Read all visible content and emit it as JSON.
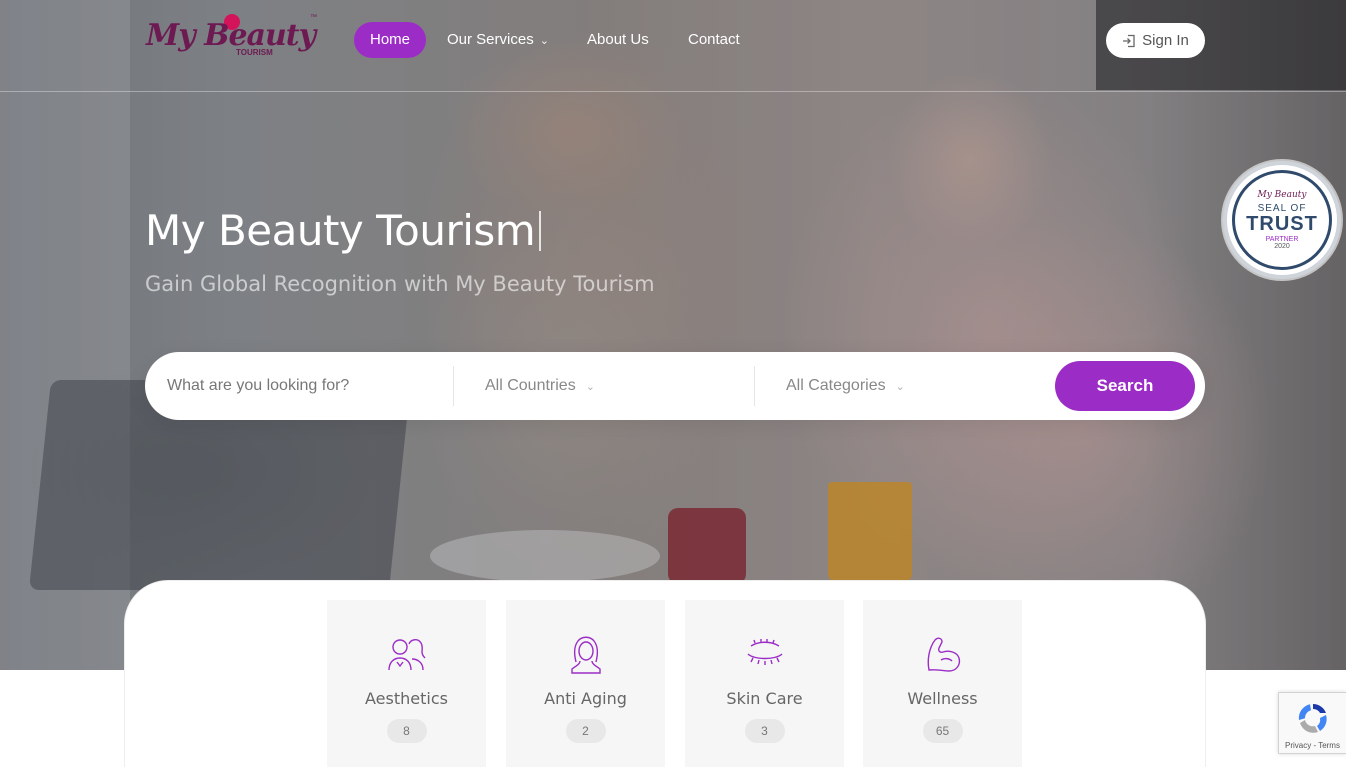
{
  "brand": {
    "logo_text": "My Beauty",
    "logo_sub": "TOURISM",
    "logo_tm": "™",
    "accent_color": "#9b2dc6",
    "logo_color": "#6d1a52"
  },
  "nav": {
    "items": [
      {
        "label": "Home",
        "active": true
      },
      {
        "label": "Our Services",
        "has_dropdown": true
      },
      {
        "label": "About Us"
      },
      {
        "label": "Contact"
      }
    ],
    "signin_label": "Sign In",
    "signin_icon": "sign-in-icon"
  },
  "hero": {
    "title": "My Beauty Tourism",
    "subtitle": "Gain Global Recognition with My Beauty Tourism"
  },
  "seal": {
    "brand": "My Beauty",
    "line1": "SEAL OF",
    "line2": "TRUST",
    "line3": "PARTNER",
    "year": "2020"
  },
  "search": {
    "placeholder": "What are you looking for?",
    "country_value": "All Countries",
    "category_value": "All Categories",
    "button_label": "Search"
  },
  "categories": [
    {
      "label": "Aesthetics",
      "count": "8",
      "icon": "couple-icon"
    },
    {
      "label": "Anti Aging",
      "count": "2",
      "icon": "woman-portrait-icon"
    },
    {
      "label": "Skin Care",
      "count": "3",
      "icon": "closed-eye-lashes-icon"
    },
    {
      "label": "Wellness",
      "count": "65",
      "icon": "flexed-arm-icon"
    }
  ],
  "recaptcha": {
    "links": "Privacy - Terms"
  }
}
